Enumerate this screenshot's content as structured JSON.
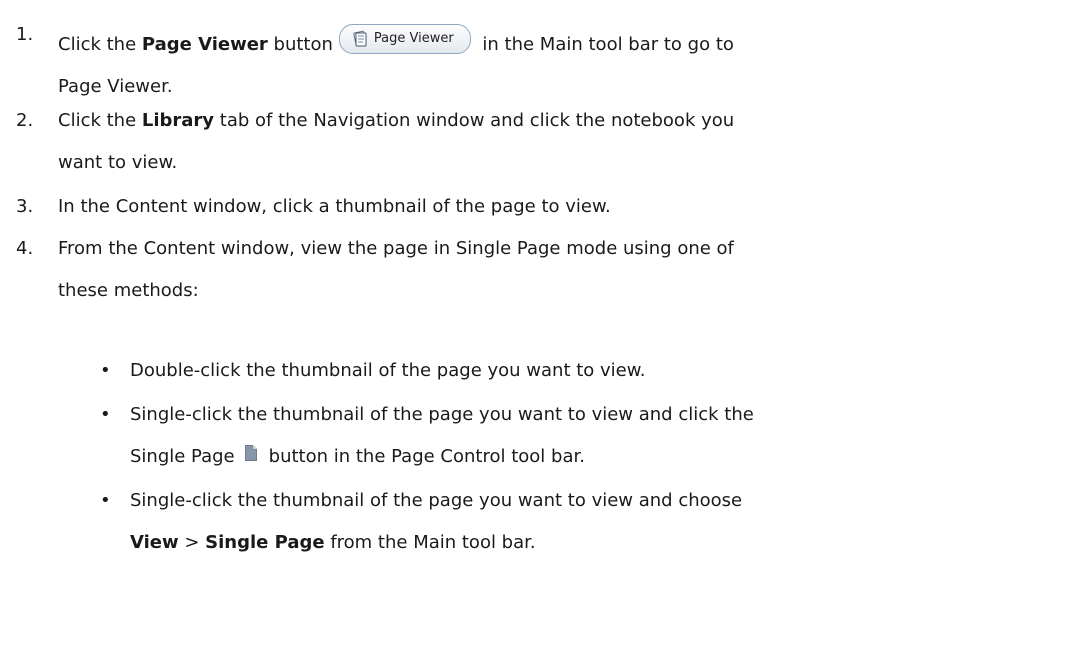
{
  "steps": [
    {
      "number": "1.",
      "pre": "Click the ",
      "bold": "Page Viewer",
      "mid": " button",
      "button_label": "Page Viewer",
      "post": " in the Main tool bar to go to",
      "line2": "Page Viewer."
    },
    {
      "number": "2.",
      "pre": "Click the ",
      "bold": "Library",
      "post": " tab of the Navigation window and click the notebook you",
      "line2": "want to view."
    },
    {
      "number": "3.",
      "text": "In the Content window, click a thumbnail of the page to view."
    },
    {
      "number": "4.",
      "text": "From the Content window, view the page in Single Page mode using one of",
      "line2": "these methods:"
    }
  ],
  "methods": [
    {
      "text": "Double-click the thumbnail of the page you want to view."
    },
    {
      "text": "Single-click the thumbnail of the page you want to view and click the",
      "line2_pre": "Single Page",
      "line2_post": "button in the Page Control tool bar."
    },
    {
      "text": "Single-click the thumbnail of the page you want to view and choose",
      "line2_bold1": "View",
      "line2_sep": " > ",
      "line2_bold2": "Single Page",
      "line2_post": " from the Main tool bar."
    }
  ],
  "icons": {
    "page_viewer_button_icon": "page-viewer-icon",
    "single_page_icon": "single-page-icon"
  }
}
